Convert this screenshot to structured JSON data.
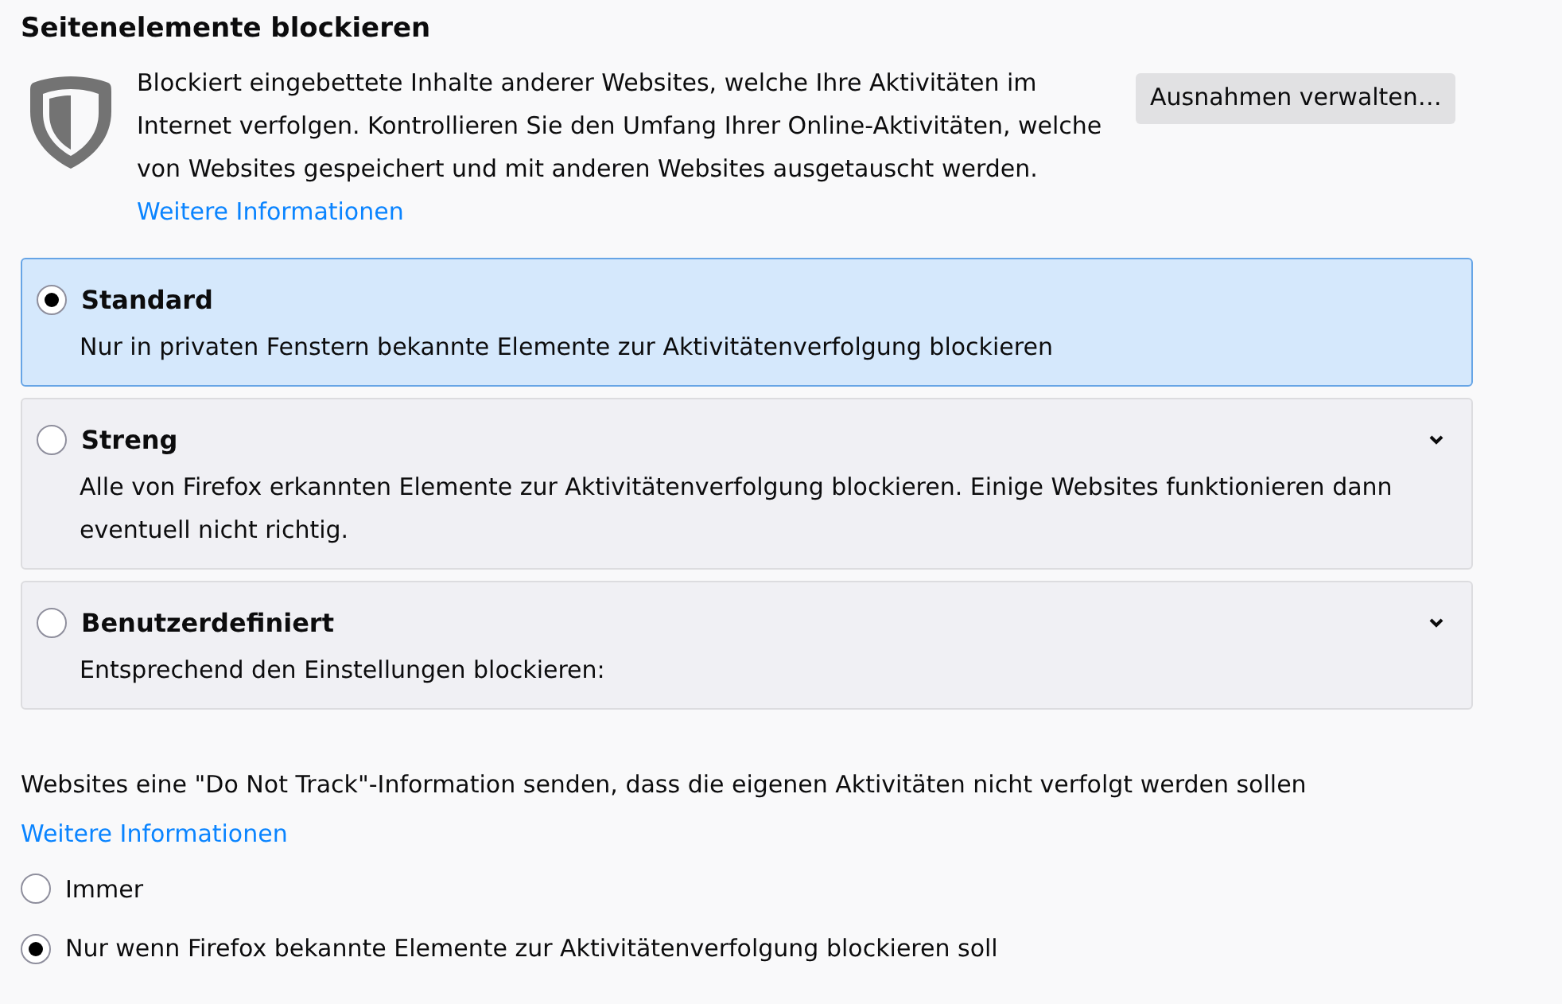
{
  "section": {
    "title": "Seitenelemente blockieren",
    "description": "Blockiert eingebettete Inhalte anderer Websites, welche Ihre Aktivitäten im Internet verfolgen. Kontrollieren Sie den Umfang Ihrer Online-Aktivitäten, welche von Websites gespeichert und mit anderen Websites ausgetauscht werden.",
    "learn_more": "Weitere Informationen",
    "exceptions_button": "Ausnahmen verwalten…"
  },
  "blocking_options": [
    {
      "label": "Standard",
      "description": "Nur in privaten Fenstern bekannte Elemente zur Aktivitätenverfolgung blockieren",
      "selected": true,
      "has_details": false
    },
    {
      "label": "Streng",
      "description": "Alle von Firefox erkannten Elemente zur Aktivitätenverfolgung blockieren. Einige Websites funktionieren dann eventuell nicht richtig.",
      "selected": false,
      "has_details": true
    },
    {
      "label": "Benutzerdefiniert",
      "description": "Entsprechend den Einstellungen blockieren:",
      "selected": false,
      "has_details": true
    }
  ],
  "do_not_track": {
    "description": "Websites eine \"Do Not Track\"-Information senden, dass die eigenen Aktivitäten nicht verfolgt werden sollen",
    "learn_more": "Weitere Informationen",
    "options": [
      {
        "label": "Immer",
        "selected": false
      },
      {
        "label": "Nur wenn Firefox bekannte Elemente zur Aktivitätenverfolgung blockieren soll",
        "selected": true
      }
    ]
  }
}
